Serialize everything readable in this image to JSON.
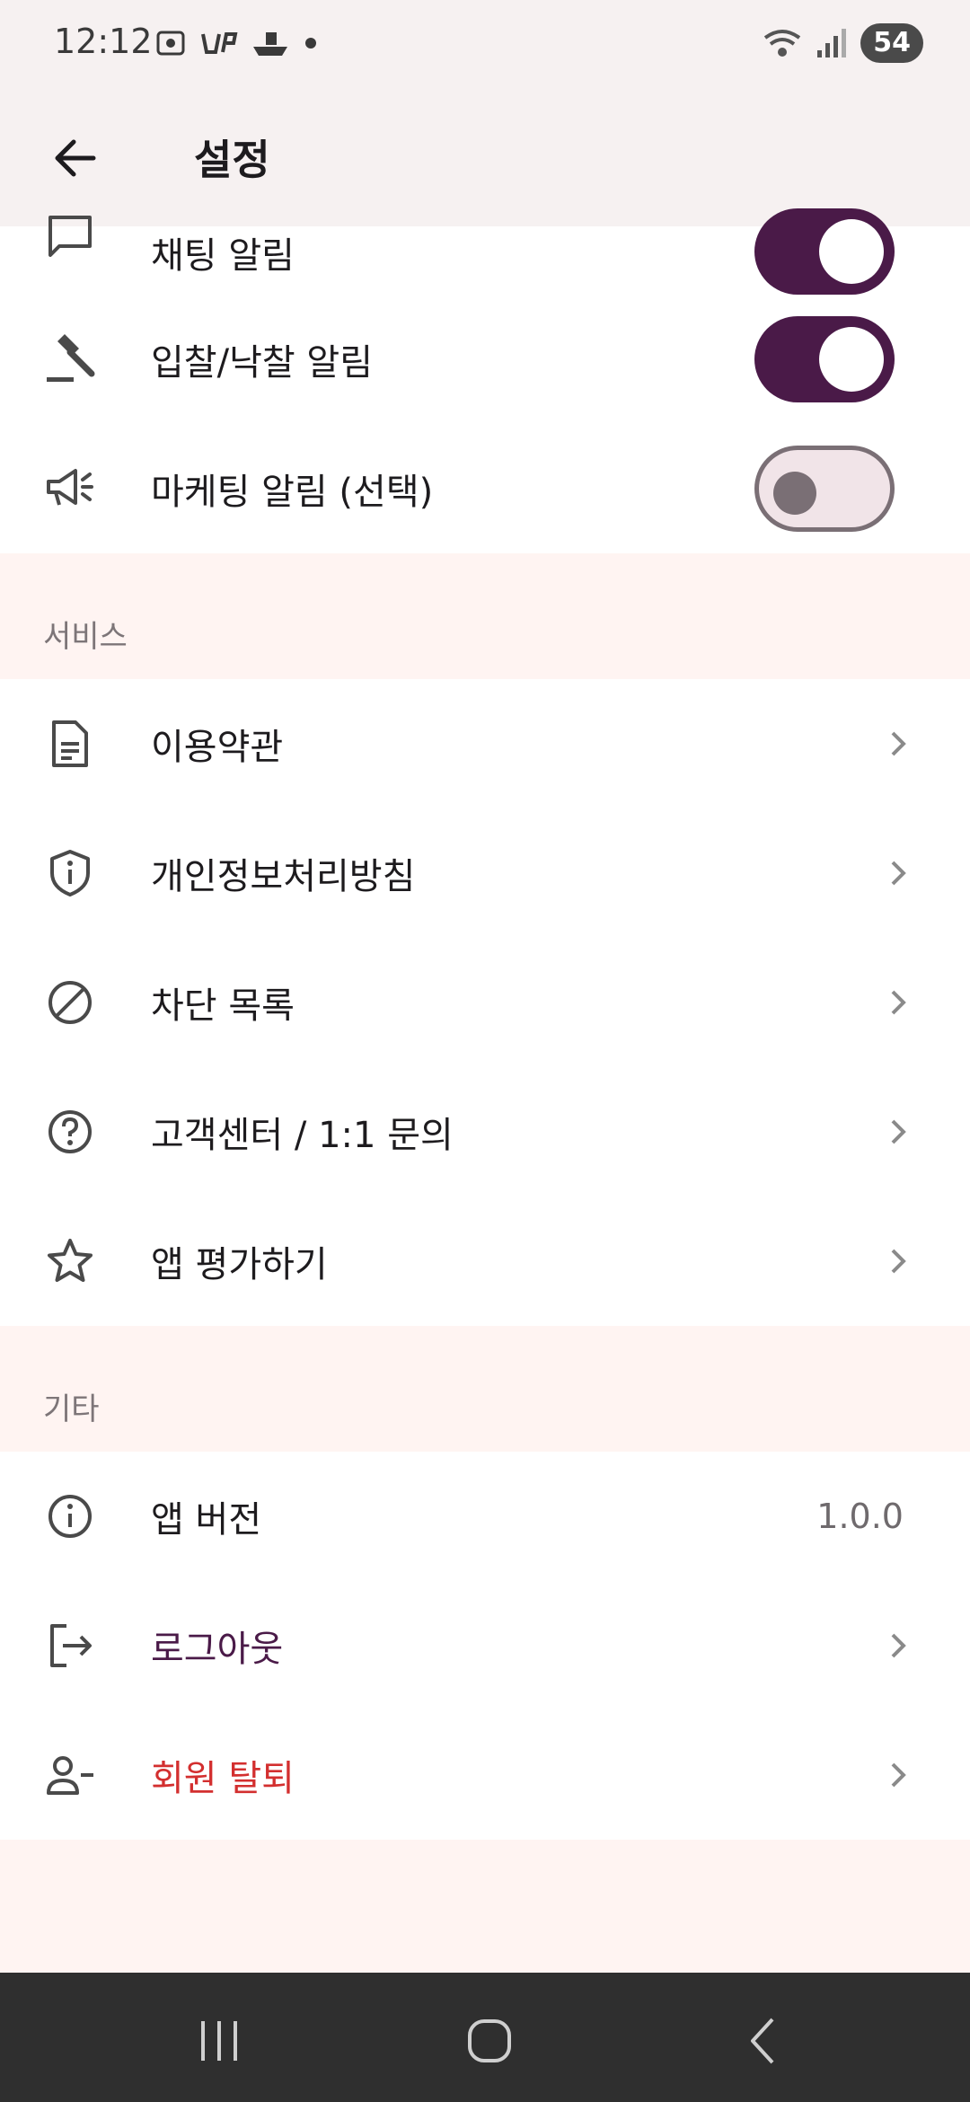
{
  "status_bar": {
    "time": "12:12",
    "battery": "54",
    "left_icons": [
      "screenshot-icon",
      "up-app-icon",
      "boat-app-icon",
      "dot-icon"
    ],
    "right_icons": [
      "wifi-icon",
      "signal-icon"
    ]
  },
  "app_bar": {
    "title": "설정",
    "back_icon": "arrow-left-icon"
  },
  "notifications": [
    {
      "label": "채팅 알림",
      "icon": "chat-bubble-icon",
      "enabled": true
    },
    {
      "label": "입찰/낙찰 알림",
      "icon": "gavel-icon",
      "enabled": true
    },
    {
      "label": "마케팅 알림 (선택)",
      "icon": "megaphone-icon",
      "enabled": false
    }
  ],
  "service_section": {
    "header": "서비스",
    "items": [
      {
        "label": "이용약관",
        "icon": "document-icon"
      },
      {
        "label": "개인정보처리방침",
        "icon": "shield-info-icon"
      },
      {
        "label": "차단 목록",
        "icon": "block-icon"
      },
      {
        "label": "고객센터 / 1:1 문의",
        "icon": "help-circle-icon"
      },
      {
        "label": "앱 평가하기",
        "icon": "star-icon"
      }
    ]
  },
  "other_section": {
    "header": "기타",
    "app_version_label": "앱 버전",
    "app_version_value": "1.0.0",
    "logout_label": "로그아웃",
    "withdraw_label": "회원 탈퇴"
  },
  "colors": {
    "accent": "#4a1a48",
    "logout_text": "#4a1a48",
    "withdraw_text": "#d32f2f",
    "section_bg": "#fff4f2",
    "appbar_bg": "#f6f1f1"
  },
  "nav_bar": {
    "icons": [
      "recent-apps-icon",
      "home-icon",
      "back-icon"
    ]
  }
}
